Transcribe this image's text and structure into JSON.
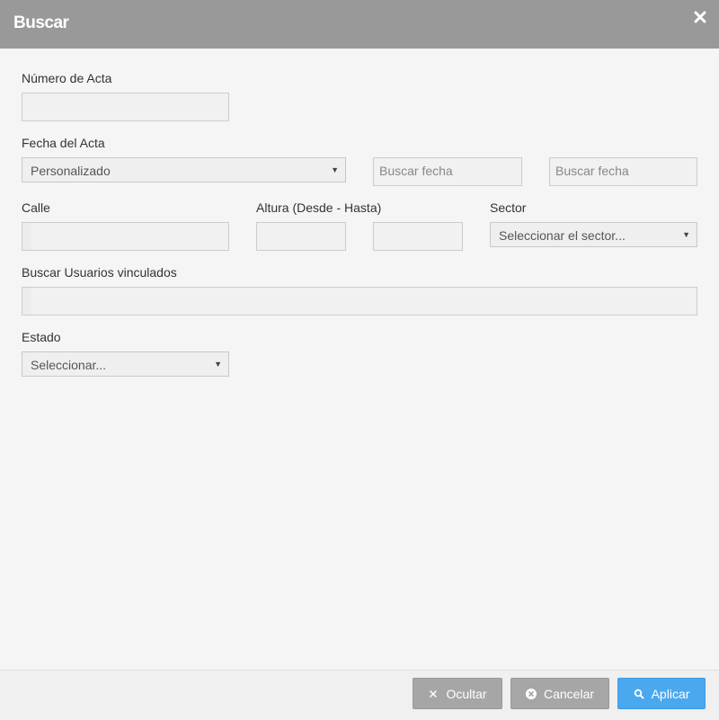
{
  "dialog": {
    "title": "Buscar",
    "close_icon": "close-icon"
  },
  "form": {
    "numero_acta": {
      "label": "Número de Acta",
      "value": ""
    },
    "fecha_acta": {
      "label": "Fecha del Acta",
      "selected": "Personalizado",
      "desde_placeholder": "Buscar fecha",
      "hasta_placeholder": "Buscar fecha"
    },
    "calle": {
      "label": "Calle",
      "value": ""
    },
    "altura": {
      "label": "Altura (Desde - Hasta)",
      "desde": "",
      "hasta": ""
    },
    "sector": {
      "label": "Sector",
      "selected": "Seleccionar el sector..."
    },
    "usuarios": {
      "label": "Buscar Usuarios vinculados",
      "value": ""
    },
    "estado": {
      "label": "Estado",
      "selected": "Seleccionar..."
    }
  },
  "footer": {
    "ocultar_label": "Ocultar",
    "cancelar_label": "Cancelar",
    "aplicar_label": "Aplicar"
  },
  "colors": {
    "header_bg": "#999999",
    "primary_button": "#4aa8ee",
    "secondary_button": "#a6a6a6"
  }
}
